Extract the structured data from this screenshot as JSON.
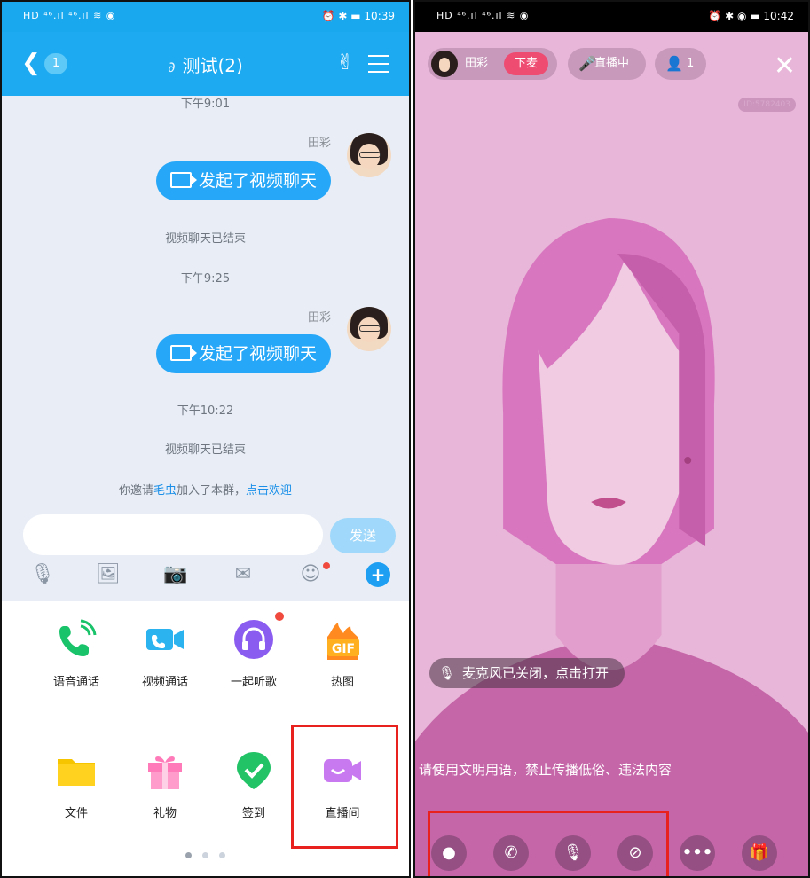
{
  "left": {
    "status_bar": {
      "left": "HD ⁴⁶.ıl ⁴⁶.ıl ≋ ◉",
      "right": "⏰ ✱ ▬ 10:39"
    },
    "nav": {
      "back_badge": "1",
      "title": "测试(2)"
    },
    "messages": [
      {
        "time": "下午9:01",
        "sender": "田彩",
        "text": "发起了视频聊天",
        "system": "视频聊天已结束"
      },
      {
        "time": "下午9:25",
        "sender": "田彩",
        "text": "发起了视频聊天"
      }
    ],
    "time3": "下午10:22",
    "system2": "视频聊天已结束",
    "invite": {
      "prefix": "你邀请",
      "name": "毛虫",
      "middle": "加入了本群，",
      "link": "点击欢迎"
    },
    "send_label": "发送",
    "grid": [
      {
        "label": "语音通话",
        "icon": "phone-icon"
      },
      {
        "label": "视频通话",
        "icon": "video-call-icon"
      },
      {
        "label": "一起听歌",
        "icon": "headphones-icon"
      },
      {
        "label": "热图",
        "icon": "gif-icon"
      },
      {
        "label": "文件",
        "icon": "folder-icon"
      },
      {
        "label": "礼物",
        "icon": "gift-icon"
      },
      {
        "label": "签到",
        "icon": "checkin-icon"
      },
      {
        "label": "直播间",
        "icon": "live-room-icon"
      }
    ]
  },
  "right": {
    "status_bar": {
      "left": "HD ⁴⁶.ıl ⁴⁶.ıl ≋ ◉",
      "right": "⏰ ✱ ◉ ▬ 10:42"
    },
    "host_name": "田彩",
    "xiamai": "下麦",
    "live_status": "直播中",
    "viewer_count": "1",
    "room_id": "ID:5782403",
    "mic_tip": "麦克风已关闭，点击打开",
    "notice": "请使用文明用语，禁止传播低俗、违法内容",
    "controls": [
      "chat-icon",
      "phone-icon",
      "mic-off-icon",
      "camera-off-icon",
      "more-icon",
      "gift-icon"
    ],
    "colors": {
      "bg": "#e8b6d8",
      "hair": "#d977c0",
      "accent": "#ef4c72"
    }
  }
}
